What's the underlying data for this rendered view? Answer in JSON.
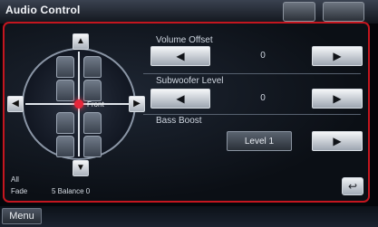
{
  "window": {
    "title": "Audio Control",
    "top_buttons": [
      "",
      ""
    ]
  },
  "speaker_panel": {
    "up_arrow": "▲",
    "down_arrow": "▼",
    "left_arrow": "◀",
    "right_arrow": "▶",
    "front_label": "Front",
    "bottom_rows": [
      {
        "label": "All",
        "value": ""
      },
      {
        "label": "Fade",
        "value": "5 Balance 0"
      }
    ]
  },
  "controls": {
    "volume_offset": {
      "label": "Volume Offset",
      "value": "0",
      "minus": "◀",
      "plus": "▶"
    },
    "subwoofer_level": {
      "label": "Subwoofer Level",
      "value": "0",
      "minus": "◀",
      "plus": "▶"
    },
    "bass_boost": {
      "label": "Bass Boost",
      "value": "Level 1",
      "plus": "▶"
    }
  },
  "footer": {
    "back_icon": "↩",
    "menu_label": "Menu"
  },
  "colors": {
    "accent_border": "#c4161f",
    "listening_point": "#e8263a"
  }
}
